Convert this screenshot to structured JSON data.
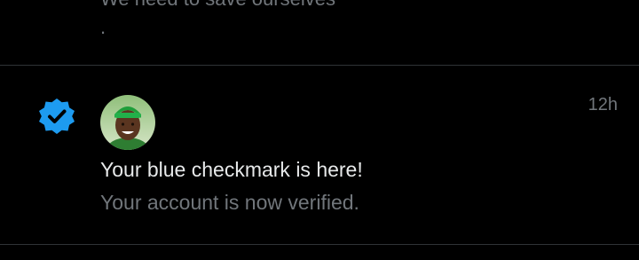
{
  "previous_notification": {
    "text": "We need to save ourselves",
    "trailing": "."
  },
  "notification": {
    "icon": "verified-badge-icon",
    "timestamp": "12h",
    "title": "Your blue checkmark is here!",
    "body": "Your account is now verified."
  },
  "colors": {
    "background": "#000000",
    "divider": "#2f3336",
    "primary_text": "#e7e9ea",
    "secondary_text": "#71767b",
    "verified_blue": "#1d9bf0"
  }
}
